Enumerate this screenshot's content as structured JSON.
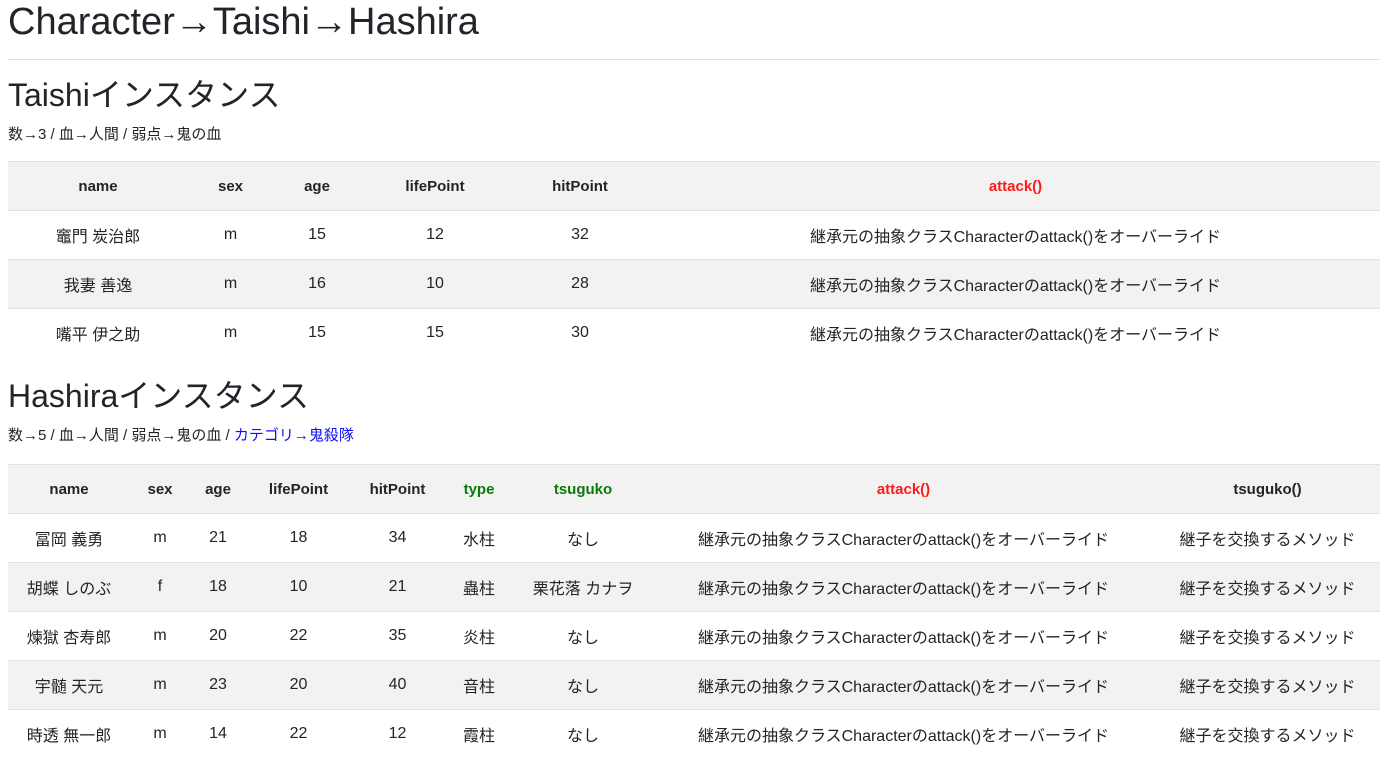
{
  "page_title": "Character→Taishi→Hashira",
  "taishi": {
    "heading": "Taishiインスタンス",
    "summary": "数→3 / 血→人間 / 弱点→鬼の血",
    "columns": [
      "name",
      "sex",
      "age",
      "lifePoint",
      "hitPoint",
      "attack()"
    ],
    "rows": [
      [
        "竈門 炭治郎",
        "m",
        "15",
        "12",
        "32",
        "継承元の抽象クラスCharacterのattack()をオーバーライド"
      ],
      [
        "我妻 善逸",
        "m",
        "16",
        "10",
        "28",
        "継承元の抽象クラスCharacterのattack()をオーバーライド"
      ],
      [
        "嘴平 伊之助",
        "m",
        "15",
        "15",
        "30",
        "継承元の抽象クラスCharacterのattack()をオーバーライド"
      ]
    ]
  },
  "hashira": {
    "heading": "Hashiraインスタンス",
    "summary": "数→5 / 血→人間 / 弱点→鬼の血 / ",
    "summary_link": "カテゴリ→鬼殺隊",
    "columns": [
      "name",
      "sex",
      "age",
      "lifePoint",
      "hitPoint",
      "type",
      "tsuguko",
      "attack()",
      "tsuguko()"
    ],
    "rows": [
      [
        "冨岡 義勇",
        "m",
        "21",
        "18",
        "34",
        "水柱",
        "なし",
        "継承元の抽象クラスCharacterのattack()をオーバーライド",
        "継子を交換するメソッド"
      ],
      [
        "胡蝶 しのぶ",
        "f",
        "18",
        "10",
        "21",
        "蟲柱",
        "栗花落 カナヲ",
        "継承元の抽象クラスCharacterのattack()をオーバーライド",
        "継子を交換するメソッド"
      ],
      [
        "煉獄 杏寿郎",
        "m",
        "20",
        "22",
        "35",
        "炎柱",
        "なし",
        "継承元の抽象クラスCharacterのattack()をオーバーライド",
        "継子を交換するメソッド"
      ],
      [
        "宇髄 天元",
        "m",
        "23",
        "20",
        "40",
        "音柱",
        "なし",
        "継承元の抽象クラスCharacterのattack()をオーバーライド",
        "継子を交換するメソッド"
      ],
      [
        "時透 無一郎",
        "m",
        "14",
        "22",
        "12",
        "霞柱",
        "なし",
        "継承元の抽象クラスCharacterのattack()をオーバーライド",
        "継子を交換するメソッド"
      ]
    ]
  },
  "colors": {
    "attack_header": "#ff1a1a",
    "added_field_header": "#0a7a0a",
    "link": "#0d0dff",
    "stripe": "#f2f2f2"
  }
}
